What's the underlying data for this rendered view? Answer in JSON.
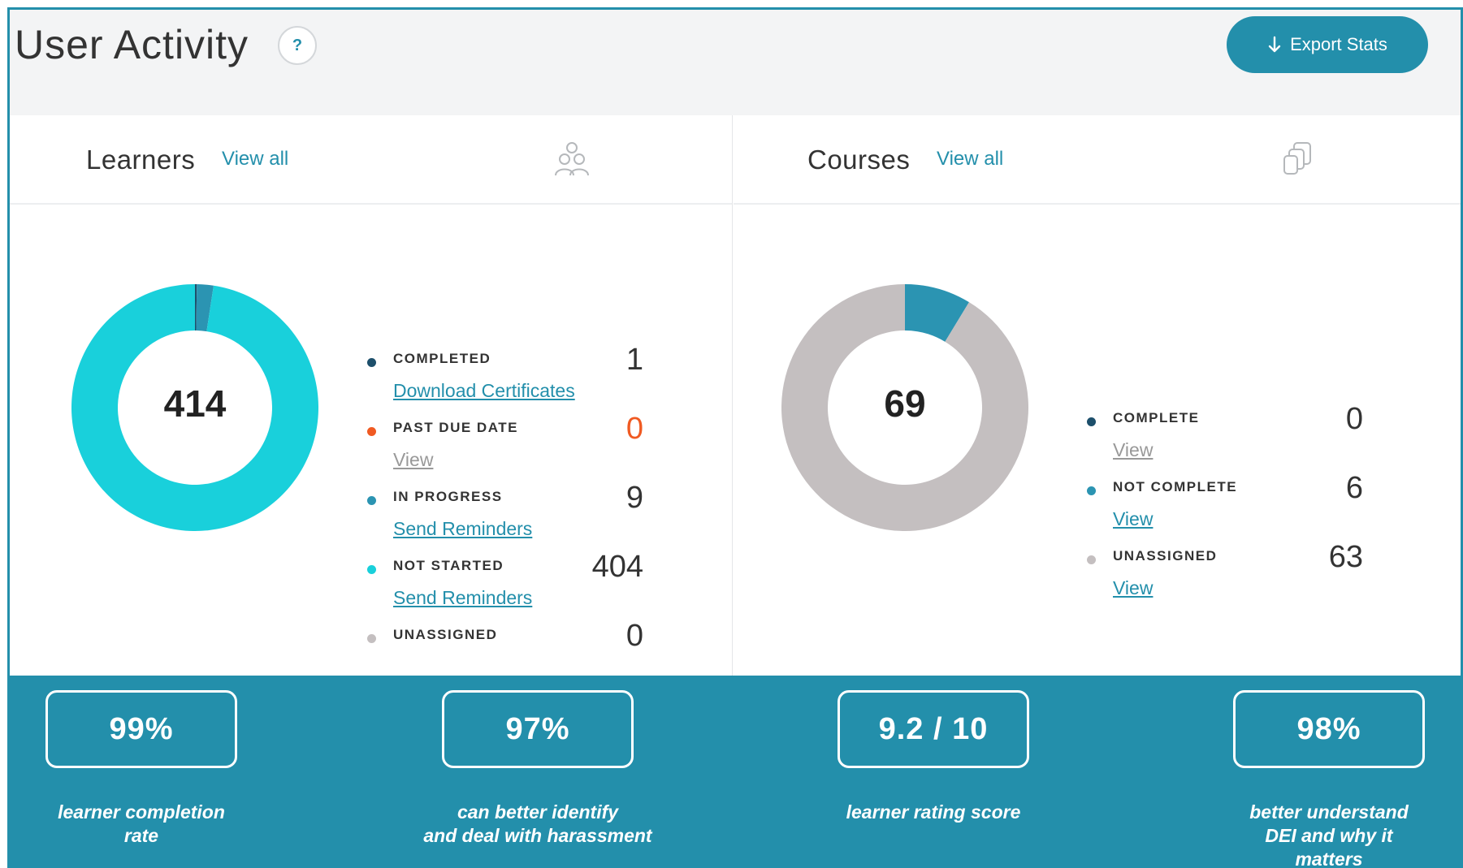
{
  "header": {
    "title": "User Activity",
    "help_label": "?",
    "export_label": "Export Stats"
  },
  "colors": {
    "accent": "#238fab",
    "completed": "#1d4f6b",
    "past_due": "#f05a22",
    "in_progress": "#2b94b2",
    "not_started": "#19d0db",
    "unassigned": "#c4bfc0"
  },
  "learners": {
    "title": "Learners",
    "view_all": "View all",
    "icon": "users-icon",
    "total": "414",
    "legend": [
      {
        "label": "COMPLETED",
        "value": "1",
        "link": "Download Certificates",
        "color": "#1d4f6b"
      },
      {
        "label": "PAST DUE DATE",
        "value": "0",
        "link": "View",
        "color": "#f05a22"
      },
      {
        "label": "IN PROGRESS",
        "value": "9",
        "link": "Send Reminders",
        "color": "#2b94b2"
      },
      {
        "label": "NOT STARTED",
        "value": "404",
        "link": "Send Reminders",
        "color": "#19d0db"
      },
      {
        "label": "UNASSIGNED",
        "value": "0",
        "link": "",
        "color": "#c4bfc0"
      }
    ]
  },
  "courses": {
    "title": "Courses",
    "view_all": "View all",
    "icon": "copy-icon",
    "total": "69",
    "legend": [
      {
        "label": "COMPLETE",
        "value": "0",
        "link": "View",
        "color": "#1d4f6b"
      },
      {
        "label": "NOT COMPLETE",
        "value": "6",
        "link": "View",
        "color": "#2b94b2"
      },
      {
        "label": "UNASSIGNED",
        "value": "63",
        "link": "View",
        "color": "#c4bfc0"
      }
    ]
  },
  "stats": [
    {
      "value": "99%",
      "caption_line1": "learner completion",
      "caption_line2": "rate",
      "caption_line3": ""
    },
    {
      "value": "97%",
      "caption_line1": "can better identify",
      "caption_line2": "and deal with harassment",
      "caption_line3": ""
    },
    {
      "value": "9.2 / 10",
      "caption_line1": "learner rating score",
      "caption_line2": "",
      "caption_line3": ""
    },
    {
      "value": "98%",
      "caption_line1": "better understand",
      "caption_line2": "DEI and why it",
      "caption_line3": "matters"
    }
  ]
}
